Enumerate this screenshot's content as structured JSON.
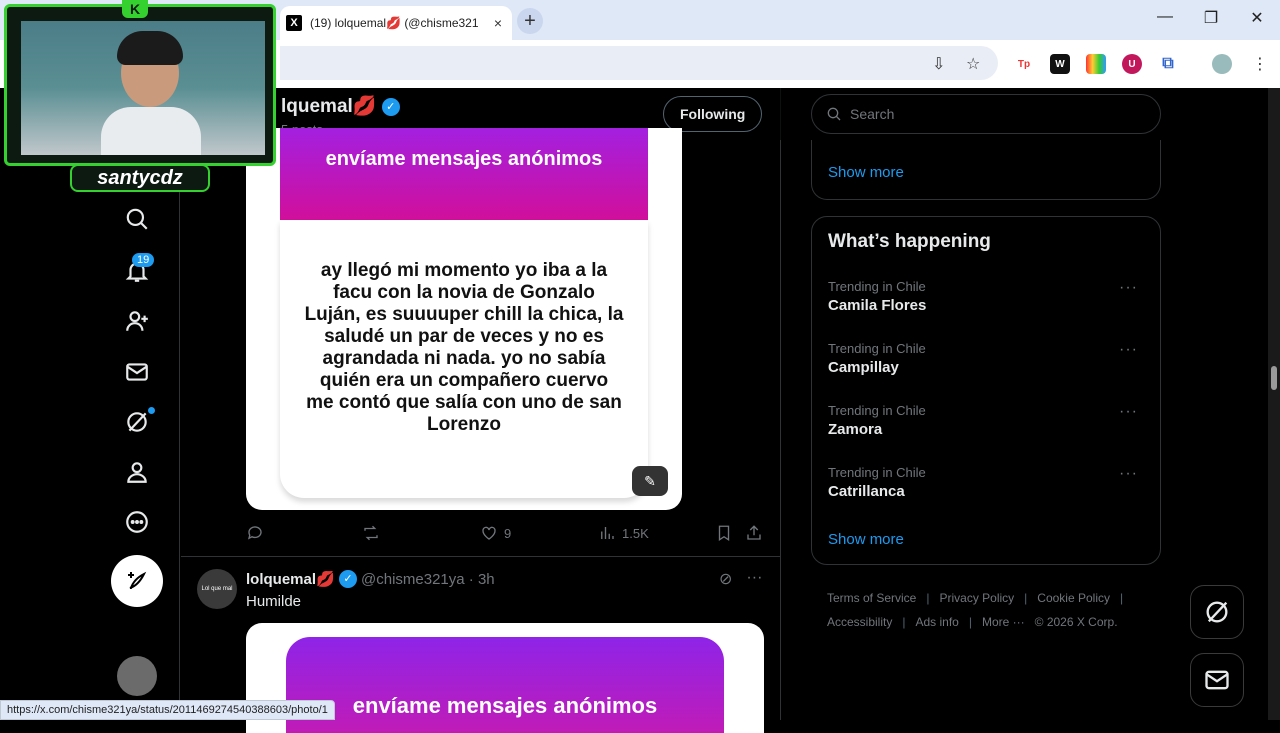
{
  "browser": {
    "tab_title": "(19) lolquemal💋 (@chisme321",
    "tab_close": "×",
    "new_tab": "+",
    "win_minimize": "—",
    "win_restore": "❐",
    "win_close": "✕",
    "status_url": "https://x.com/chisme321ya/status/2011469274540388603/photo/1"
  },
  "header": {
    "profile_name": "lquemal💋",
    "post_count": "5 posts",
    "follow_label": "Following"
  },
  "left_nav": {
    "notifications_badge": "19"
  },
  "post1": {
    "banner_text": "envíame mensajes anónimos",
    "body_text": "ay llegó mi momento yo iba a la facu con la novia de Gonzalo Luján, es suuuuper chill la chica, la saludé un par de veces y no es agrandada ni nada. yo no sabía quién era un compañero cuervo me contó que salía con uno de san Lorenzo",
    "likes": "9",
    "views": "1.5K"
  },
  "post2": {
    "avatar_text": "Lol que mal",
    "name": "lolquemal💋",
    "handle": "@chisme321ya · 3h",
    "text": "Humilde",
    "banner_text": "envíame mensajes anónimos"
  },
  "sidebar": {
    "search_placeholder": "Search",
    "show_more_top": "Show more",
    "whats_happening": "What’s happening",
    "trends": [
      {
        "context": "Trending in Chile",
        "title": "Camila Flores"
      },
      {
        "context": "Trending in Chile",
        "title": "Campillay"
      },
      {
        "context": "Trending in Chile",
        "title": "Zamora"
      },
      {
        "context": "Trending in Chile",
        "title": "Catrillanca"
      }
    ],
    "show_more_bottom": "Show more",
    "more_dots": "···",
    "footer": {
      "terms": "Terms of Service",
      "privacy": "Privacy Policy",
      "cookie": "Cookie Policy",
      "accessibility": "Accessibility",
      "ads": "Ads info",
      "more": "More ···",
      "copyright": "© 2026 X Corp."
    }
  },
  "webcam": {
    "streamer_name": "santycdz",
    "logo": "K"
  },
  "colors": {
    "accent": "#1d9bf0",
    "cam_border": "#35d12f"
  }
}
